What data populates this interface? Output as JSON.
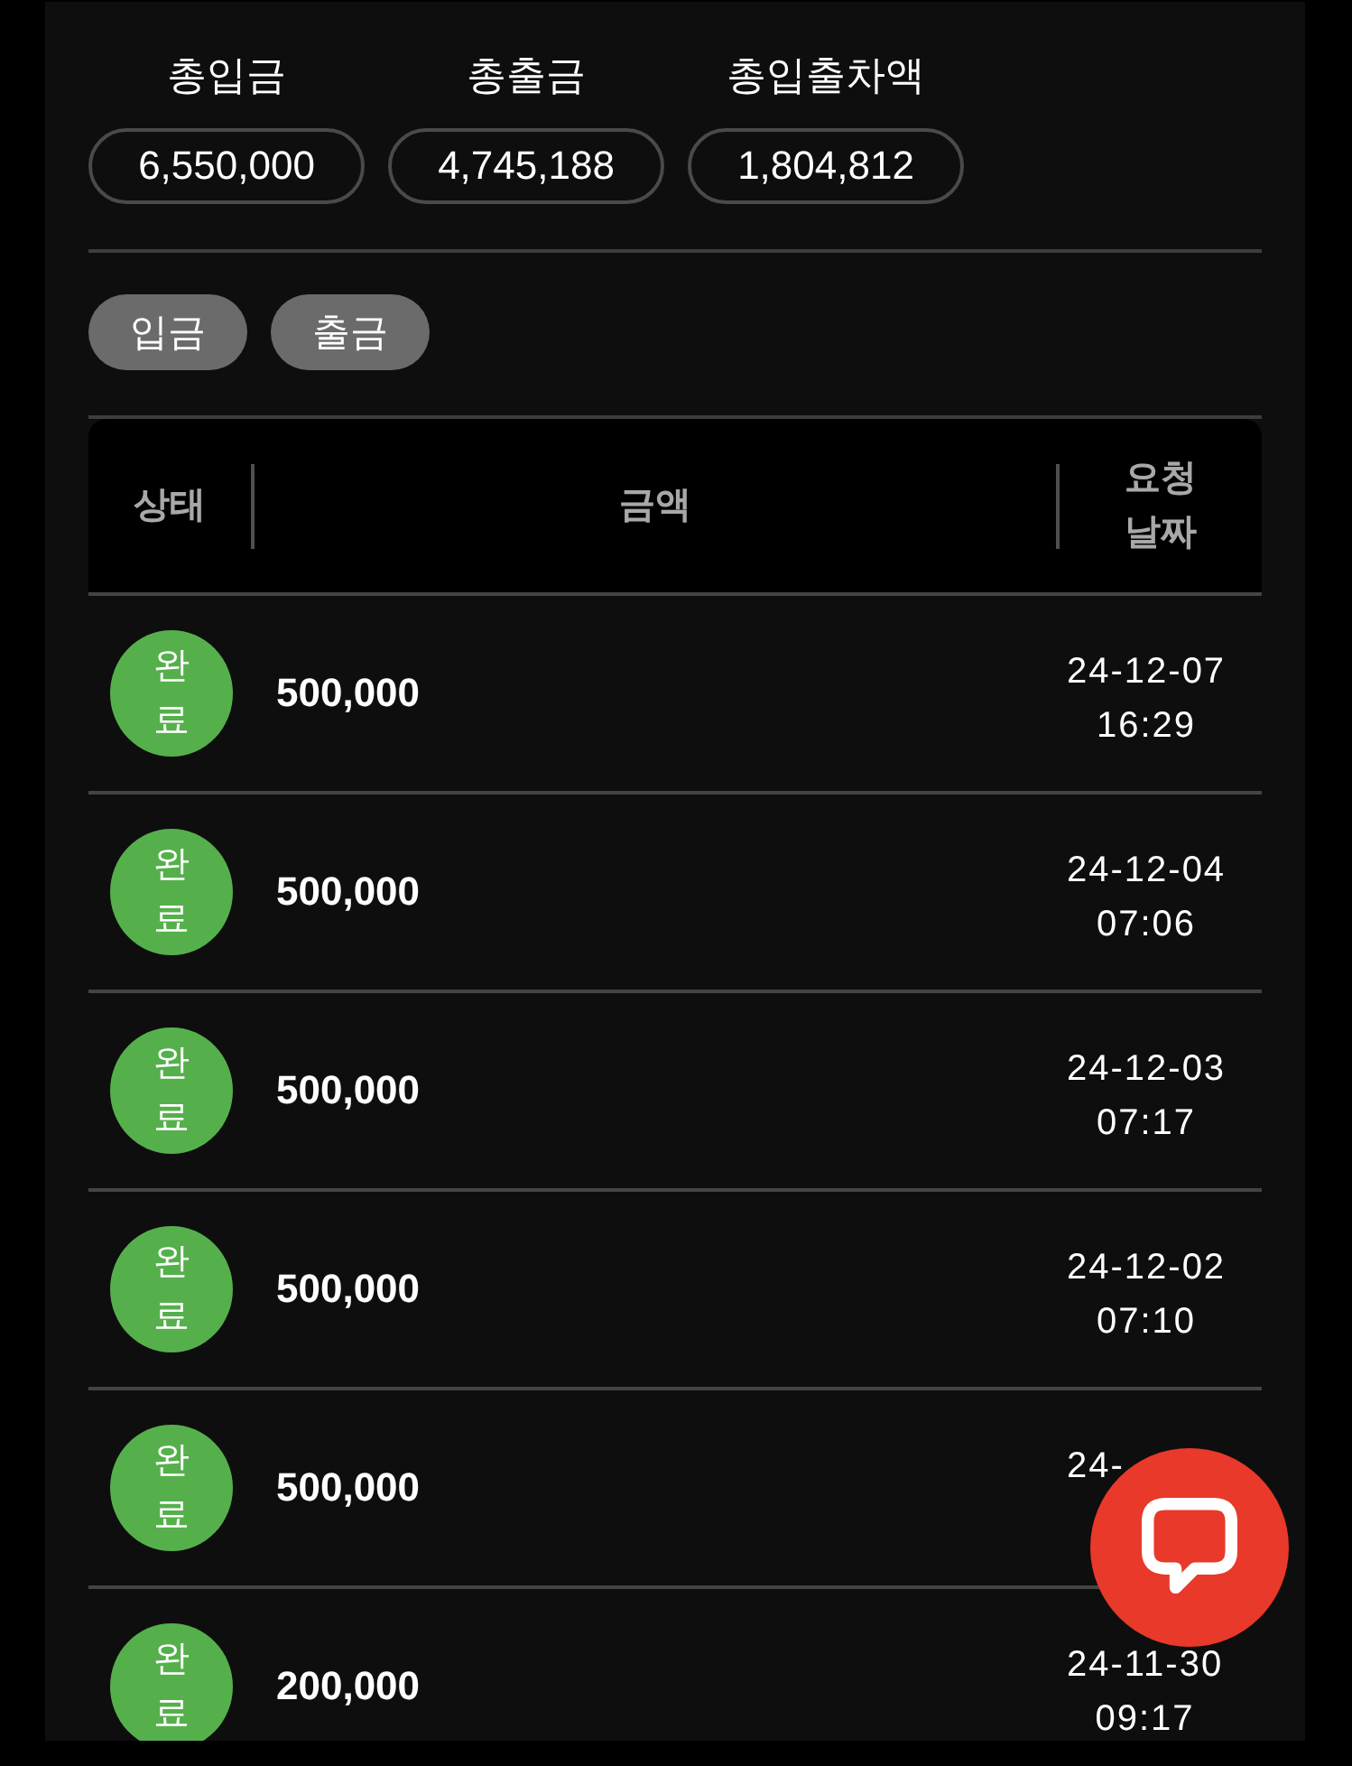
{
  "summary": [
    {
      "label": "총입금",
      "value": "6,550,000"
    },
    {
      "label": "총출금",
      "value": "4,745,188"
    },
    {
      "label": "총입출차액",
      "value": "1,804,812"
    }
  ],
  "filter_buttons": [
    {
      "label": "입금"
    },
    {
      "label": "출금"
    }
  ],
  "table": {
    "columns": [
      "상태",
      "금액",
      "요청 날짜"
    ],
    "rows": [
      {
        "status": "완료",
        "amount": "500,000",
        "date": "24-12-07",
        "time": "16:29"
      },
      {
        "status": "완료",
        "amount": "500,000",
        "date": "24-12-04",
        "time": "07:06"
      },
      {
        "status": "완료",
        "amount": "500,000",
        "date": "24-12-03",
        "time": "07:17"
      },
      {
        "status": "완료",
        "amount": "500,000",
        "date": "24-12-02",
        "time": "07:10"
      },
      {
        "status": "완료",
        "amount": "500,000",
        "date": "24-"
      },
      {
        "status": "완료",
        "amount": "200,000",
        "date": "24-11-30",
        "time": "09:17"
      }
    ]
  }
}
